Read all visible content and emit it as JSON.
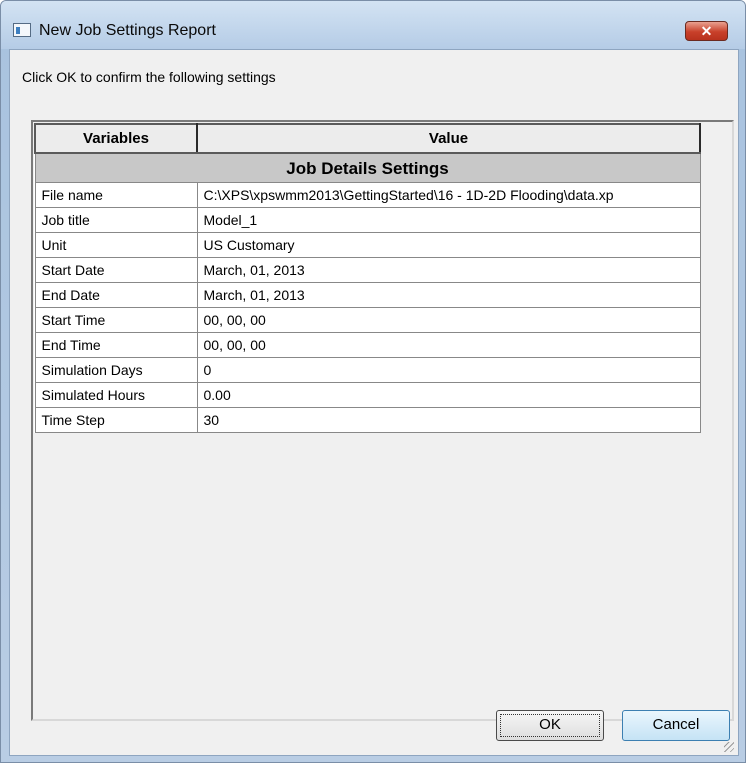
{
  "window": {
    "title": "New Job Settings Report",
    "close_glyph": "✕"
  },
  "dialog": {
    "prompt": "Click OK to confirm the following settings"
  },
  "table": {
    "headers": [
      "Variables",
      "Value"
    ],
    "section": "Job Details Settings",
    "rows": [
      {
        "variable": "File name",
        "value": "C:\\XPS\\xpswmm2013\\GettingStarted\\16 - 1D-2D Flooding\\data.xp"
      },
      {
        "variable": "Job title",
        "value": "Model_1"
      },
      {
        "variable": "Unit",
        "value": "US Customary"
      },
      {
        "variable": "Start Date",
        "value": "March, 01, 2013"
      },
      {
        "variable": "End Date",
        "value": "March, 01, 2013"
      },
      {
        "variable": "Start Time",
        "value": "00, 00, 00"
      },
      {
        "variable": "End Time",
        "value": "00, 00, 00"
      },
      {
        "variable": "Simulation Days",
        "value": "0"
      },
      {
        "variable": "Simulated Hours",
        "value": "0.00"
      },
      {
        "variable": "Time Step",
        "value": "30"
      }
    ]
  },
  "buttons": {
    "ok": "OK",
    "cancel": "Cancel"
  }
}
